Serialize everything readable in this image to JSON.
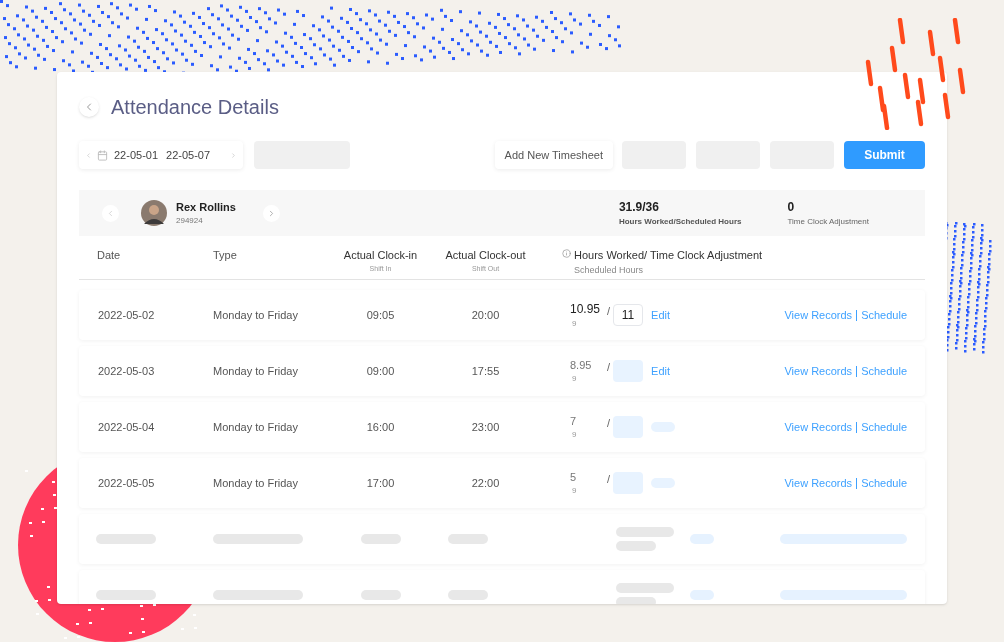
{
  "page": {
    "title": "Attendance Details"
  },
  "toolbar": {
    "date_range": {
      "start": "22-05-01",
      "end": "22-05-07"
    },
    "add_button": "Add New Timesheet",
    "submit_button": "Submit"
  },
  "employee": {
    "name": "Rex Rollins",
    "id": "294924",
    "summary": [
      {
        "value": "31.9/36",
        "label": "Hours Worked/Scheduled Hours"
      },
      {
        "value": "0",
        "label": "Time Clock Adjustment"
      }
    ]
  },
  "table": {
    "columns": [
      {
        "label": "Date"
      },
      {
        "label": "Type"
      },
      {
        "label": "Actual Clock-in",
        "sublabel": "Shift In"
      },
      {
        "label": "Actual Clock-out",
        "sublabel": "Shift Out"
      },
      {
        "label": "Hours Worked/ Time Clock Adjustment",
        "sublabel": "Scheduled Hours",
        "info": true
      }
    ],
    "rows": [
      {
        "kind": "entry",
        "date": "2022-05-02",
        "type": "Monday to Friday",
        "clock_in": "09:05",
        "clock_out": "20:00",
        "hours_worked": "10.95",
        "scheduled": "9",
        "separator": "/",
        "adjustment": "11",
        "edit": "Edit",
        "actions": [
          "View Records",
          "Schedule"
        ]
      },
      {
        "kind": "entry",
        "date": "2022-05-03",
        "type": "Monday to Friday",
        "clock_in": "09:00",
        "clock_out": "17:55",
        "hours_worked": "8.95",
        "scheduled": "9",
        "separator": "/",
        "edit": "Edit",
        "actions": [
          "View Records",
          "Schedule"
        ]
      },
      {
        "kind": "entry",
        "date": "2022-05-04",
        "type": "Monday to Friday",
        "clock_in": "16:00",
        "clock_out": "23:00",
        "hours_worked": "7",
        "scheduled": "9",
        "separator": "/",
        "actions": [
          "View Records",
          "Schedule"
        ]
      },
      {
        "kind": "entry",
        "date": "2022-05-05",
        "type": "Monday to Friday",
        "clock_in": "17:00",
        "clock_out": "22:00",
        "hours_worked": "5",
        "scheduled": "9",
        "separator": "/",
        "actions": [
          "View Records",
          "Schedule"
        ]
      },
      {
        "kind": "loading"
      },
      {
        "kind": "loading"
      }
    ]
  }
}
